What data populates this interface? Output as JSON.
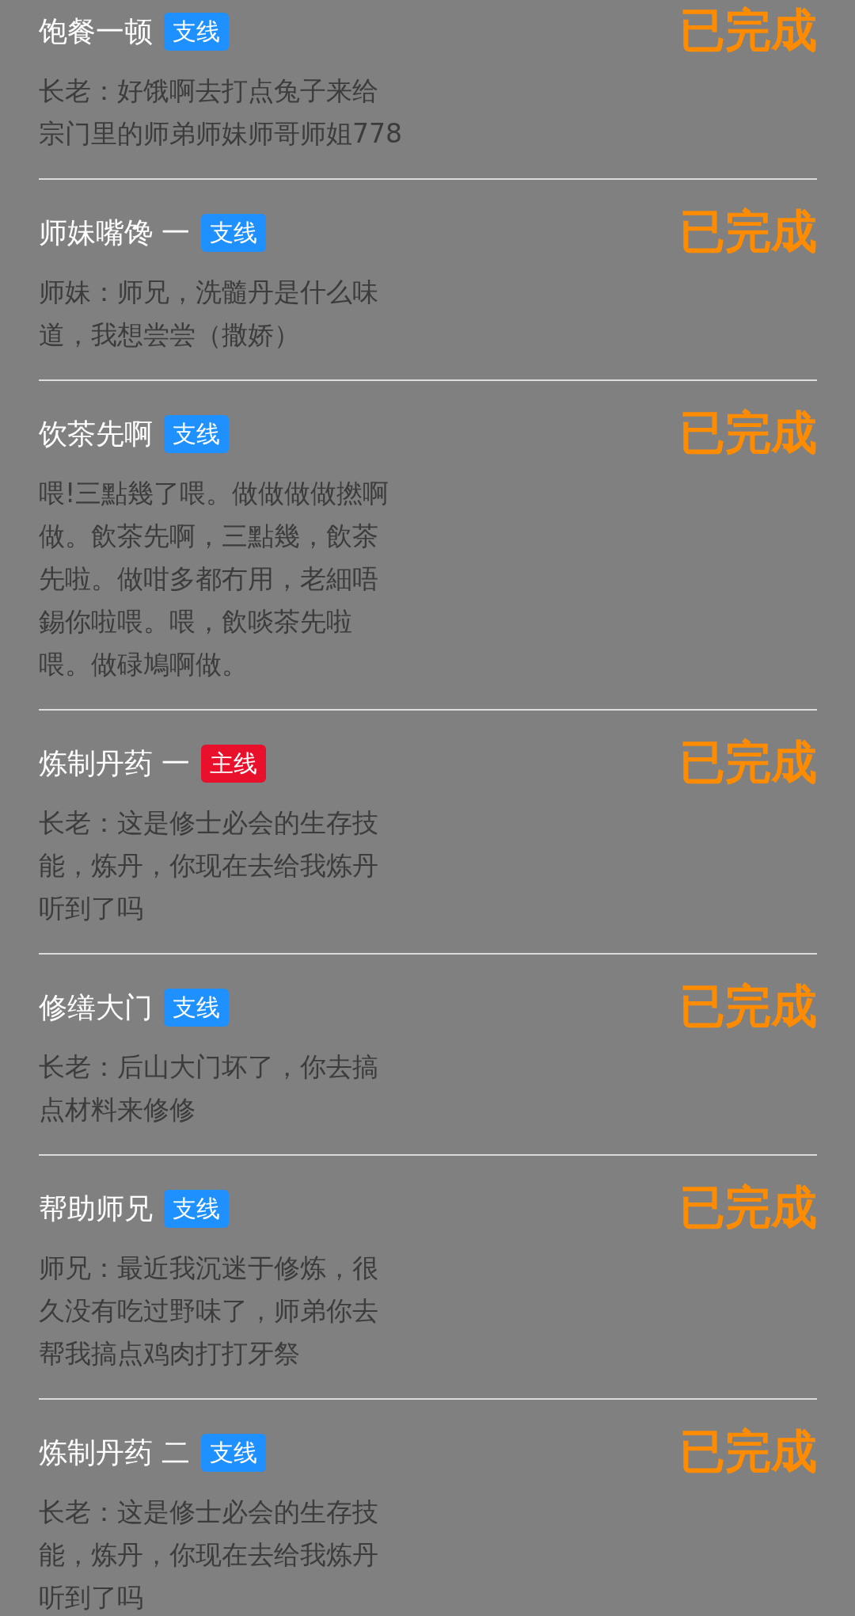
{
  "quests": [
    {
      "title": "饱餐一顿",
      "tag": {
        "label": "支线",
        "kind": "side"
      },
      "description": "长老：好饿啊去打点兔子来给宗门里的师弟师妹师哥师姐778",
      "status": "已完成"
    },
    {
      "title": "师妹嘴馋 一",
      "tag": {
        "label": "支线",
        "kind": "side"
      },
      "description": "师妹：师兄，洗髓丹是什么味道，我想尝尝（撒娇）",
      "status": "已完成"
    },
    {
      "title": "饮茶先啊",
      "tag": {
        "label": "支线",
        "kind": "side"
      },
      "description": "喂!三點幾了喂。做做做做撚啊做。飲茶先啊，三點幾，飲茶先啦。做咁多都冇用，老細唔錫你啦喂。喂，飲啖茶先啦喂。做碌鳩啊做。",
      "status": "已完成"
    },
    {
      "title": "炼制丹药 一",
      "tag": {
        "label": "主线",
        "kind": "main"
      },
      "description": "长老：这是修士必会的生存技能，炼丹，你现在去给我炼丹听到了吗",
      "status": "已完成"
    },
    {
      "title": "修缮大门",
      "tag": {
        "label": "支线",
        "kind": "side"
      },
      "description": "长老：后山大门坏了，你去搞点材料来修修",
      "status": "已完成"
    },
    {
      "title": "帮助师兄",
      "tag": {
        "label": "支线",
        "kind": "side"
      },
      "description": "师兄：最近我沉迷于修炼，很久没有吃过野味了，师弟你去帮我搞点鸡肉打打牙祭",
      "status": "已完成"
    },
    {
      "title": "炼制丹药 二",
      "tag": {
        "label": "支线",
        "kind": "side"
      },
      "description": "长老：这是修士必会的生存技能，炼丹，你现在去给我炼丹听到了吗",
      "status": "已完成"
    }
  ]
}
